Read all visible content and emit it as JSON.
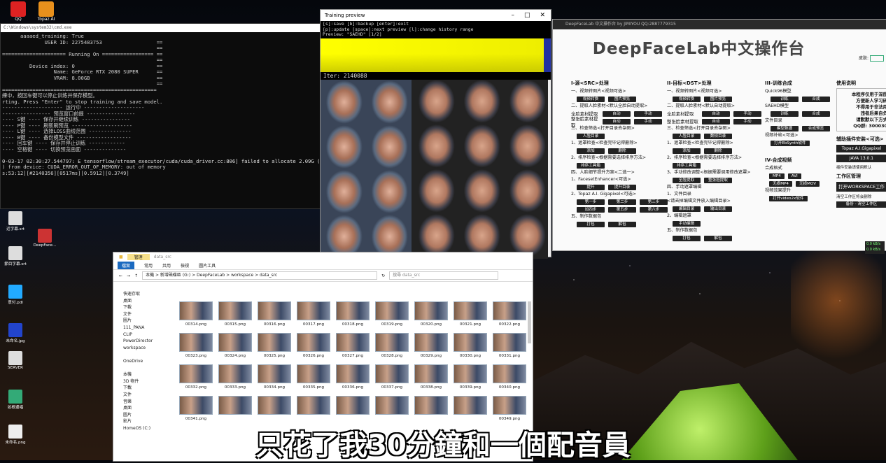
{
  "desktop_top": [
    {
      "label": "QQ",
      "color": "#d22"
    },
    {
      "label": "Topaz AI",
      "color": "#e8901c"
    }
  ],
  "console": {
    "path": "C:\\Windows\\system32\\cmd.exe",
    "lines": [
      "      aaaaed_training: True",
      "              USER ID: 2275483753                  ==",
      "                                                   ==",
      "===================== Running On ================= ==",
      "                                                   ==",
      "         Device index: 0                           ==",
      "                 Name: GeForce RTX 2080 SUPER      ==",
      "                 VRAM: 8.00GB                      ==",
      "                                                   ==",
      "===================================================",
      "練中，按回车键可以停止训练并保存模型。",
      "rting. Press \"Enter\" to stop training and save model.",
      "-------------------- 运行中 --------------------",
      "---------------- 预览窗口前提 ----------------",
      "---- S键 ---- 保存并继续训练 ----------------",
      "---- P键 ---- 刷新刷预览 --------------------",
      "---- L键 ---- 选择LOSS曲线范围 --------------",
      "---- B键 ---- 备份模型文件 ------------------",
      "---- 回车键 ---- 保存并停止训练 ------------",
      "---- 空格键 ---- 切换预览画面 --------------",
      "",
      "0-03-17 02:30:27.544797: E tensorflow/stream_executor/cuda/cuda_driver.cc:806] failed to allocate 2.09G (22484)",
      ") from device: CUDA_ERROR_OUT_OF_MEMORY: out of memory",
      "s:53:12][#2140356][0517ms][0.5912][0.3749]"
    ]
  },
  "preview": {
    "title": "Training preview",
    "info1": "[s]:save [b]:backup [enter]:exit",
    "info2": "[p]:update [space]:next preview [l]:change history range",
    "info3": "Preview: \"SAEHD\" [1/2]",
    "iter": "Iter: 2140088"
  },
  "dfl": {
    "titlebar": "DeepFaceLab 中文操作台 by JIMIYOU QQ:2887779315",
    "title": "DeepFaceLab中文操作台",
    "skin_label": "皮肤:",
    "col1": {
      "header": "I-源<SRC>处理",
      "items": [
        {
          "t": "一、视频转图片<视频可选>",
          "b": []
        },
        {
          "t": "",
          "b": [
            "视频转换",
            "图片预览"
          ]
        },
        {
          "t": "二、提取人脸素材<默认全脸自动提取>",
          "b": []
        },
        {
          "t": "全脸素材提取",
          "b": [
            "自动",
            "手动"
          ]
        },
        {
          "t": "整张脸素材提取",
          "b": [
            "自动",
            "手动"
          ]
        },
        {
          "t": "三、检查筛选<打开目录去杂图>",
          "b": []
        },
        {
          "t": "",
          "b": [
            "人脸目录"
          ]
        },
        {
          "t": "1、遮罩检查<检查完毕记得删除>",
          "b": []
        },
        {
          "t": "",
          "b": [
            "添加",
            "删除"
          ]
        },
        {
          "t": "2、排序检查<根据需要选择排序方法>",
          "b": []
        },
        {
          "t": "",
          "b": [
            "排序工具箱"
          ]
        },
        {
          "t": "四、人脸细节提升方案<二选一>",
          "b": []
        },
        {
          "t": "1、FacesetEnhancer<可选>",
          "b": []
        },
        {
          "t": "",
          "b": [
            "提升",
            "提升目录"
          ]
        },
        {
          "t": "2、Topaz A.I. Gigapixel<可选>",
          "b": []
        },
        {
          "t": "",
          "b": [
            "第一步",
            "第二步",
            "第三步"
          ]
        },
        {
          "t": "",
          "b": [
            "加四步",
            "第五步",
            "第六步"
          ]
        },
        {
          "t": "五、制作数据包",
          "b": []
        },
        {
          "t": "",
          "b": [
            "打包",
            "解包"
          ]
        }
      ]
    },
    "col2": {
      "header": "II-目标<DST>处理",
      "items": [
        {
          "t": "一、视频转图片<视频可选>",
          "b": []
        },
        {
          "t": "",
          "b": [
            "视频转换",
            "图片预览"
          ]
        },
        {
          "t": "二、提取人脸素材<默认自动提取>",
          "b": []
        },
        {
          "t": "全脸素材提取",
          "b": [
            "自动",
            "手动"
          ]
        },
        {
          "t": "整张脸素材提取",
          "b": [
            "自动",
            "手动"
          ]
        },
        {
          "t": "三、检查筛选<打开目录去杂图>",
          "b": []
        },
        {
          "t": "",
          "b": [
            "人脸目录",
            "数帧目录"
          ]
        },
        {
          "t": "1、遮罩检查<检查完毕记得删除>",
          "b": []
        },
        {
          "t": "",
          "b": [
            "添加",
            "删除"
          ]
        },
        {
          "t": "2、排序检查<根据需要选择排序方法>",
          "b": []
        },
        {
          "t": "",
          "b": [
            "排序工具箱"
          ]
        },
        {
          "t": "3、手动修改调整<根据需要调用修改遮罩>",
          "b": []
        },
        {
          "t": "",
          "b": [
            "全脸提取",
            "整张脸提取"
          ]
        },
        {
          "t": "四、手动遮罩编辑",
          "b": []
        },
        {
          "t": "1、文件目录",
          "b": []
        },
        {
          "t": "<请去掉编辑文件放入编辑目录>",
          "b": []
        },
        {
          "t": "",
          "b": [
            "编辑目录",
            "输出目录"
          ]
        },
        {
          "t": "2、编辑遮罩",
          "b": []
        },
        {
          "t": "",
          "b": [
            "手动编辑"
          ]
        },
        {
          "t": "五、制作数据包",
          "b": []
        },
        {
          "t": "",
          "b": [
            "打包",
            "解包"
          ]
        }
      ]
    },
    "col3": {
      "header": "III-训练合成",
      "items": [
        {
          "t": "Quick96模型",
          "b": []
        },
        {
          "t": "",
          "b": [
            "训练",
            "合成"
          ]
        },
        {
          "t": "SAEHD模型",
          "b": []
        },
        {
          "t": "",
          "b": [
            "训练",
            "合成"
          ]
        },
        {
          "t": "文件目录",
          "b": []
        },
        {
          "t": "",
          "b": [
            "模型数据",
            "合成预览"
          ]
        },
        {
          "t": "视频补帧<可选>",
          "b": []
        },
        {
          "t": "",
          "b": [
            "打开EbSynth软件"
          ]
        }
      ],
      "header2": "IV-合成视频",
      "items2": [
        {
          "t": "合成格式",
          "b": []
        },
        {
          "t": "",
          "b": [
            "MP4",
            "AVI"
          ]
        },
        {
          "t": "",
          "b": [
            "无损MP4",
            "无损MOV"
          ]
        },
        {
          "t": "视频效果提升",
          "b": []
        },
        {
          "t": "",
          "b": [
            "打开video2x软件"
          ]
        }
      ]
    },
    "col4": {
      "header": "使用说明",
      "lines": [
        "本程序仅用于深度",
        "方便新人学习研",
        "不得用于非法用",
        "违者后果自负",
        "请默默以下方式",
        "QQ群: 300030"
      ],
      "plugin_header": "辅助插件安装<可选>",
      "plugins": [
        "Topaz A.I.Gigapixel",
        "JAVA 13.0.1"
      ],
      "plugin_note": "插件安装请使用默认",
      "workspace_header": "工作区管理",
      "workspace_btn": "打开WORKSPACE工作区",
      "workspace_note": "清空工作区将会删除",
      "backup_btn": "备份 - 清空工作区"
    }
  },
  "explorer": {
    "manage": "管理",
    "folder": "data_src",
    "tabs": [
      "檔案",
      "常用",
      "共用",
      "檢視",
      "圖片工具"
    ],
    "path": [
      "本機",
      "新增磁碟區 (G:)",
      "DeepFaceLab",
      "workspace",
      "data_src"
    ],
    "search_placeholder": "搜尋 data_src",
    "nav": [
      "快速存取",
      "桌面",
      "下載",
      "文件",
      "圖片",
      "111_PANA",
      "CLIP",
      "PowerDirector",
      "workspace",
      "",
      "OneDrive",
      "",
      "本機",
      "3D 物件",
      "下載",
      "文件",
      "音樂",
      "桌面",
      "圖片",
      "影片",
      "HomeOS (C:)"
    ],
    "files": [
      "00314.png",
      "00315.png",
      "00316.png",
      "00317.png",
      "00318.png",
      "00319.png",
      "00320.png",
      "00321.png",
      "00322.png",
      "00323.png",
      "00324.png",
      "00325.png",
      "00326.png",
      "00327.png",
      "00328.png",
      "00329.png",
      "00330.png",
      "00331.png",
      "00332.png",
      "00333.png",
      "00334.png",
      "00335.png",
      "00336.png",
      "00337.png",
      "00338.png",
      "00339.png",
      "00340.png",
      "00341.png",
      "",
      "",
      "",
      "",
      "",
      "",
      "",
      "00349.png"
    ]
  },
  "left_icons": [
    "近字幕.srt",
    "DeepFace...",
    "節目字幕.srt",
    "",
    "意付.pdl",
    "",
    "未命名.jpg",
    "",
    "SERVER",
    "",
    "如根邊唱",
    "",
    "未命名.png"
  ],
  "subtitle": "只花了我30分鐘和一個配音員",
  "tray": [
    "0.0 kB/s",
    "0.0 kB/s"
  ]
}
